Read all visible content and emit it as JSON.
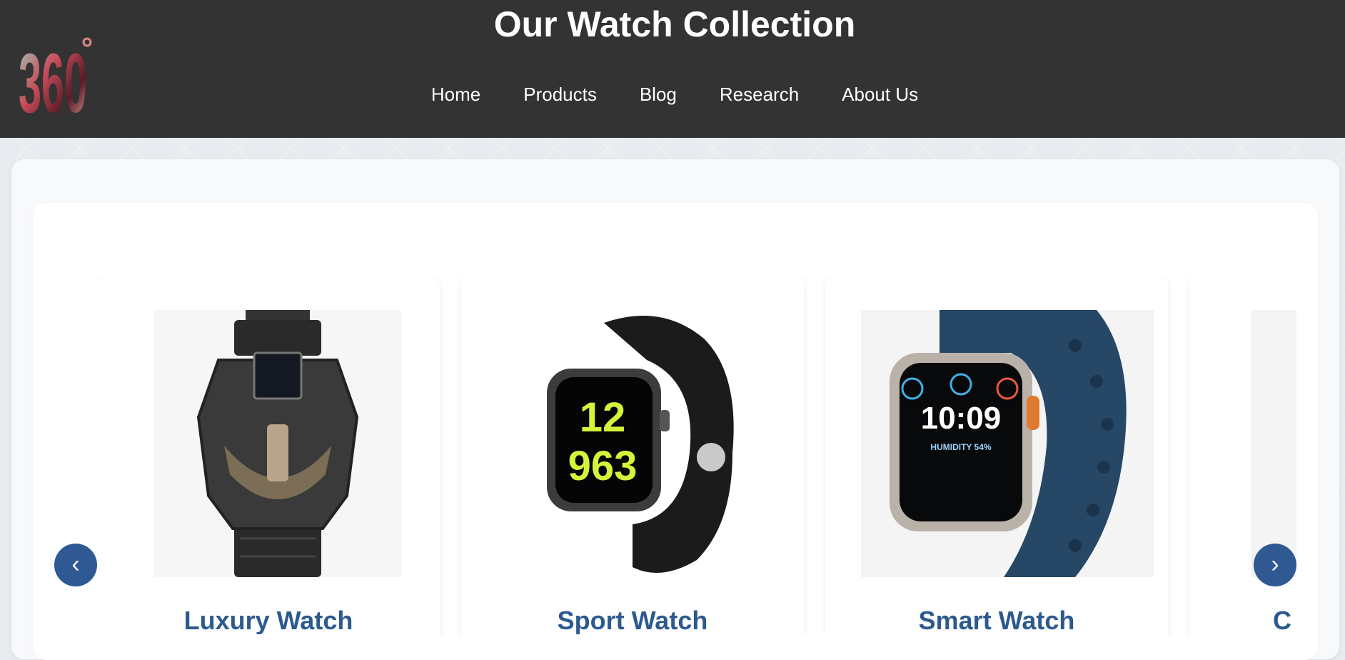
{
  "header": {
    "title": "Our Watch Collection",
    "logo_text": "360°",
    "nav": [
      {
        "label": "Home"
      },
      {
        "label": "Products"
      },
      {
        "label": "Blog"
      },
      {
        "label": "Research"
      },
      {
        "label": "About Us"
      }
    ]
  },
  "carousel": {
    "prev_label": "‹",
    "next_label": "›",
    "items": [
      {
        "name": "Luxury Watch",
        "image": "luxury-watch-image"
      },
      {
        "name": "Sport Watch",
        "image": "sport-watch-image"
      },
      {
        "name": "Smart Watch",
        "image": "smart-watch-image"
      },
      {
        "name": "C",
        "image": "partial-watch-image"
      }
    ]
  },
  "colors": {
    "header_bg": "#333333",
    "accent": "#2f5993",
    "card_title": "#2d5a8e"
  }
}
